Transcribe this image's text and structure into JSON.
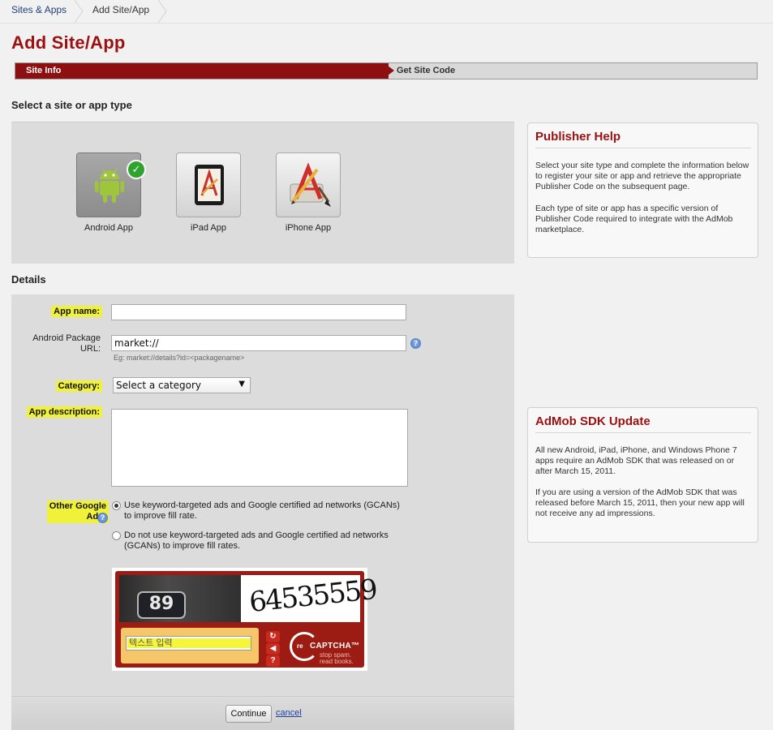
{
  "breadcrumb": {
    "items": [
      "Sites & Apps",
      "Add Site/App"
    ]
  },
  "page_title": "Add Site/App",
  "steps": {
    "active": "Site Info",
    "next": "Get Site Code"
  },
  "type_section": {
    "heading": "Select a site or app type",
    "types": [
      {
        "label": "Android App",
        "icon": "android-icon",
        "selected": true
      },
      {
        "label": "iPad App",
        "icon": "ipad-icon",
        "selected": false
      },
      {
        "label": "iPhone App",
        "icon": "iphone-app-icon",
        "selected": false
      }
    ]
  },
  "publisher_help": {
    "title": "Publisher Help",
    "paragraphs": [
      "Select your site type and complete the information below to register your site or app and retrieve the appropriate Publisher Code on the subsequent page.",
      "Each type of site or app has a specific version of Publisher Code required to integrate with the AdMob marketplace."
    ]
  },
  "sdk_update": {
    "title": "AdMob SDK Update",
    "paragraphs": [
      "All new Android, iPad, iPhone, and Windows Phone 7 apps require an AdMob SDK that was released on or after March 15, 2011.",
      "If you are using a version of the AdMob SDK that was released before March 15, 2011, then your new app will not receive any ad impressions."
    ]
  },
  "details": {
    "heading": "Details",
    "app_name": {
      "label": "App name:",
      "value": ""
    },
    "package_url": {
      "label_line1": "Android Package",
      "label_line2": "URL:",
      "value": "market://",
      "hint": "Eg: market://details?id=<packagename>"
    },
    "category": {
      "label": "Category:",
      "selected": "Select a category"
    },
    "description": {
      "label": "App description:",
      "value": ""
    },
    "other_ads": {
      "label_line1": "Other Google",
      "label_line2": "Ads:",
      "options": [
        {
          "text": "Use keyword-targeted ads and Google certified ad networks (GCANs) to improve fill rate.",
          "checked": true
        },
        {
          "text": "Do not use keyword-targeted ads and Google certified ad networks (GCANs) to improve fill rates.",
          "checked": false
        }
      ]
    }
  },
  "captcha": {
    "plate_number": "89",
    "word": "64535559",
    "input_placeholder": "텍스트 입력",
    "buttons": [
      "refresh-icon",
      "audio-icon",
      "help-icon"
    ],
    "brand_re": "re",
    "brand_name": "CAPTCHA™",
    "tagline_1": "stop spam.",
    "tagline_2": "read books."
  },
  "actions": {
    "continue": "Continue",
    "cancel": "cancel"
  },
  "colors": {
    "brand_red": "#9b1111",
    "step_red": "#8e0f0f",
    "highlight": "#f0f23a",
    "link": "#1f3f9a"
  }
}
